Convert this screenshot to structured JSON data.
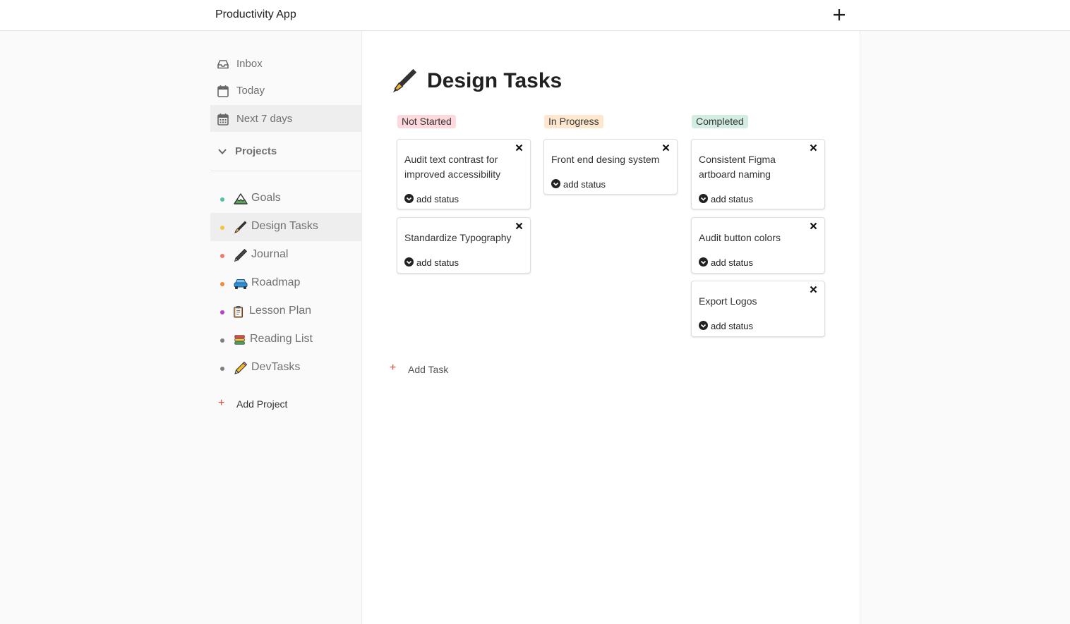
{
  "header": {
    "app_title": "Productivity App",
    "add_icon": "plus-icon"
  },
  "sidebar": {
    "nav": [
      {
        "label": "Inbox",
        "icon": "inbox-icon"
      },
      {
        "label": "Today",
        "icon": "calendar-icon"
      },
      {
        "label": "Next 7 days",
        "icon": "calendar-week-icon",
        "active": true
      }
    ],
    "projects_label": "Projects",
    "projects": [
      {
        "label": "Goals",
        "emoji": "mountain",
        "dot_color": "#4fc1a4"
      },
      {
        "label": "Design Tasks",
        "emoji": "fountain-pen",
        "dot_color": "#f5c242",
        "active": true
      },
      {
        "label": "Journal",
        "emoji": "pen",
        "dot_color": "#f4786a"
      },
      {
        "label": "Roadmap",
        "emoji": "car",
        "dot_color": "#f28b3c"
      },
      {
        "label": "Lesson Plan",
        "emoji": "clipboard",
        "dot_color": "#b63fd4"
      },
      {
        "label": "Reading List",
        "emoji": "books",
        "dot_color": "#808080"
      },
      {
        "label": "DevTasks",
        "emoji": "pencil",
        "dot_color": "#808080"
      }
    ],
    "add_project_label": "Add Project"
  },
  "main": {
    "title": "Design Tasks",
    "title_emoji": "fountain-pen",
    "columns": [
      {
        "label": "Not Started",
        "badge_color": "#fdd8dc",
        "cards": [
          {
            "title": "Audit text contrast for improved accessibility",
            "status": "add status"
          },
          {
            "title": "Standardize Typography",
            "status": "add status"
          }
        ]
      },
      {
        "label": "In Progress",
        "badge_color": "#fde8cf",
        "cards": [
          {
            "title": "Front end desing system",
            "status": "add status"
          }
        ]
      },
      {
        "label": "Completed",
        "badge_color": "#d3ede3",
        "cards": [
          {
            "title": "Consistent Figma artboard naming",
            "status": "add status"
          },
          {
            "title": "Audit button colors",
            "status": "add status"
          },
          {
            "title": "Export Logos",
            "status": "add status"
          }
        ]
      }
    ],
    "add_task_label": "Add Task"
  }
}
